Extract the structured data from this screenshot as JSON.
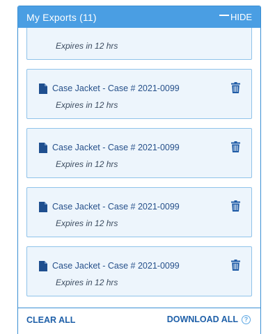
{
  "panel": {
    "title": "My Exports (11)",
    "hide_label": "HIDE"
  },
  "exports": [
    {
      "title": "",
      "expiry": "Expires in 12 hrs"
    },
    {
      "title": "Case Jacket - Case # 2021-0099",
      "expiry": "Expires in 12 hrs"
    },
    {
      "title": "Case Jacket - Case # 2021-0099",
      "expiry": "Expires in 12 hrs"
    },
    {
      "title": "Case Jacket - Case # 2021-0099",
      "expiry": "Expires in 12 hrs"
    },
    {
      "title": "Case Jacket - Case # 2021-0099",
      "expiry": "Expires in 12 hrs"
    }
  ],
  "footer": {
    "clear_all_label": "CLEAR ALL",
    "download_all_label": "DOWNLOAD ALL",
    "help_glyph": "?"
  },
  "icons": {
    "file": "file-icon",
    "trash": "trash-icon",
    "minus": "minus-icon",
    "help": "help-icon"
  },
  "colors": {
    "header_bg": "#4a9ee3",
    "card_bg": "#edf5fc",
    "card_border": "#8fc3ea",
    "link": "#1e5fa8"
  }
}
